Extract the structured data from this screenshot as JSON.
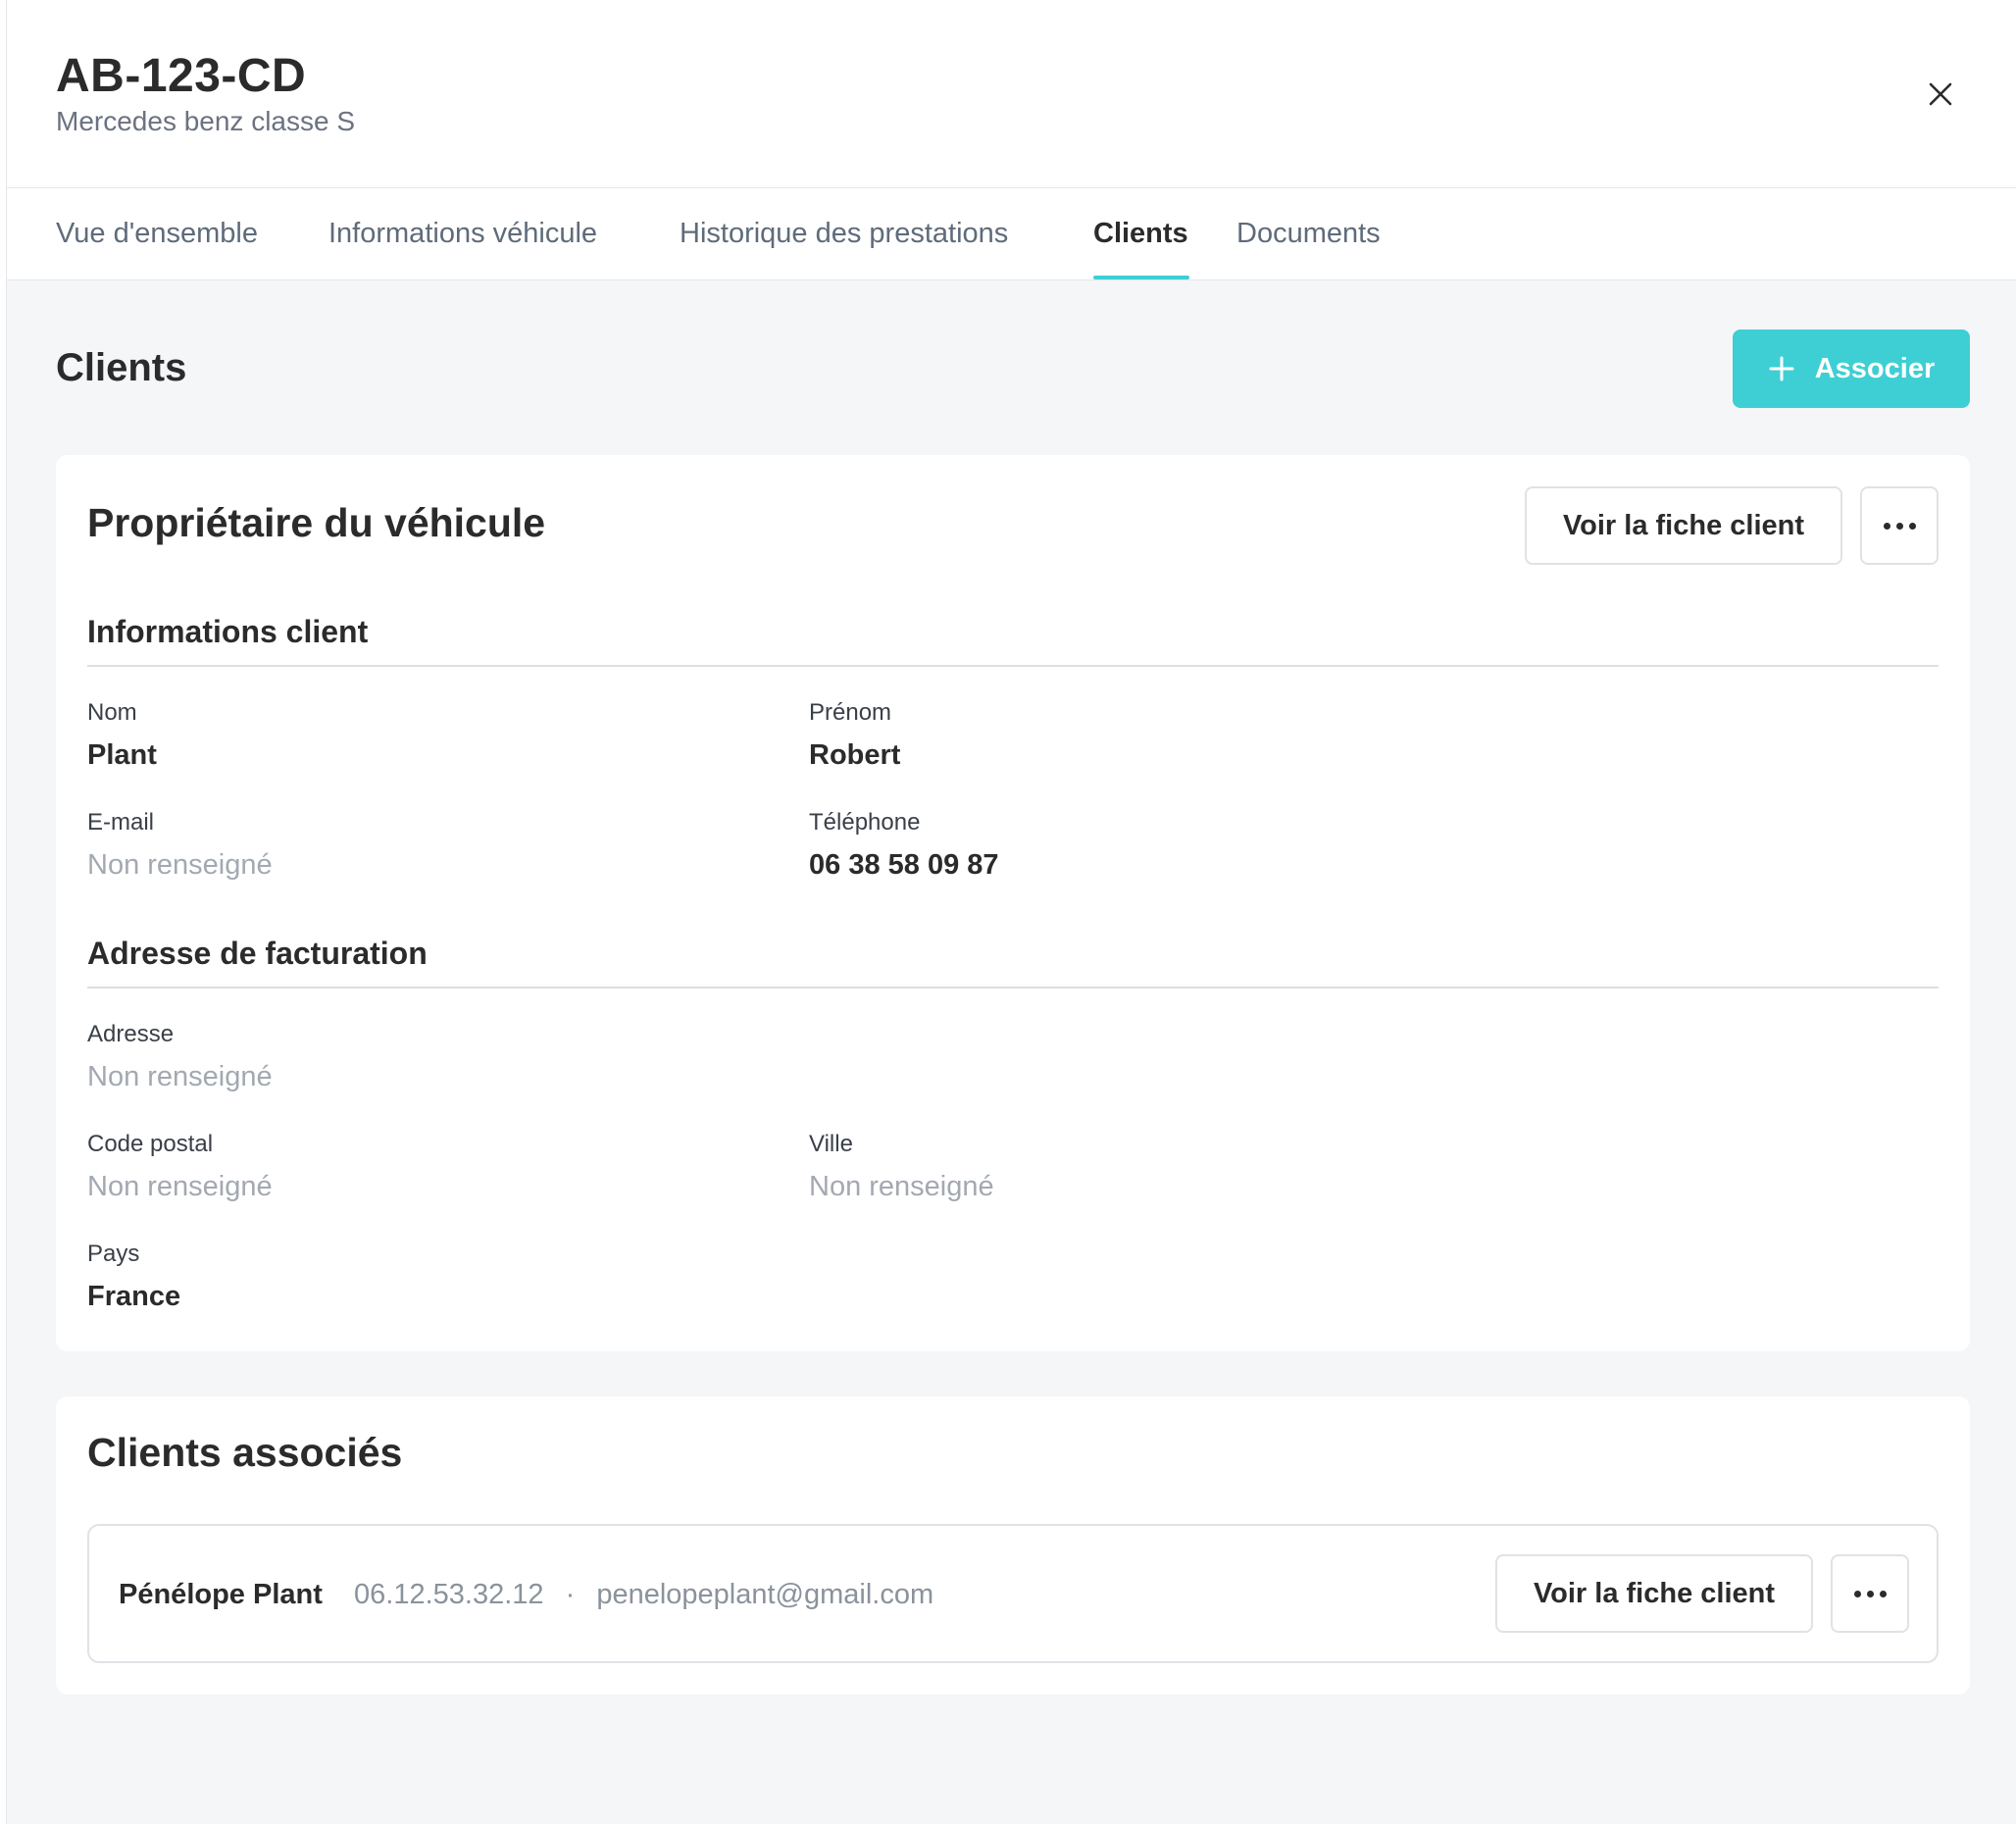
{
  "vehicle": {
    "plate": "AB-123-CD",
    "model": "Mercedes benz classe S"
  },
  "tabs": [
    {
      "label": "Vue d'ensemble",
      "active": false
    },
    {
      "label": "Informations véhicule",
      "active": false
    },
    {
      "label": "Historique des prestations",
      "active": false
    },
    {
      "label": "Clients",
      "active": true
    },
    {
      "label": "Documents",
      "active": false
    }
  ],
  "page": {
    "title": "Clients",
    "associate_button": "Associer"
  },
  "owner": {
    "title": "Propriétaire du véhicule",
    "view_button": "Voir la fiche client",
    "info_section": {
      "title": "Informations client",
      "nom_label": "Nom",
      "nom_value": "Plant",
      "prenom_label": "Prénom",
      "prenom_value": "Robert",
      "email_label": "E-mail",
      "email_value": "Non renseigné",
      "phone_label": "Téléphone",
      "phone_value": "06 38 58 09 87"
    },
    "billing_section": {
      "title": "Adresse de facturation",
      "address_label": "Adresse",
      "address_value": "Non renseigné",
      "postal_label": "Code postal",
      "postal_value": "Non renseigné",
      "city_label": "Ville",
      "city_value": "Non renseigné",
      "country_label": "Pays",
      "country_value": "France"
    }
  },
  "associated": {
    "title": "Clients associés",
    "clients": [
      {
        "name": "Pénélope Plant",
        "phone": "06.12.53.32.12",
        "separator": "·",
        "email": "penelopeplant@gmail.com",
        "view_button": "Voir la fiche client"
      }
    ]
  },
  "colors": {
    "accent": "#3ecfd4",
    "background": "#f5f6f8",
    "muted_text": "#a3a9b1"
  },
  "icons": {
    "close": "close-icon",
    "plus": "plus-icon",
    "more": "more-horizontal-icon"
  }
}
